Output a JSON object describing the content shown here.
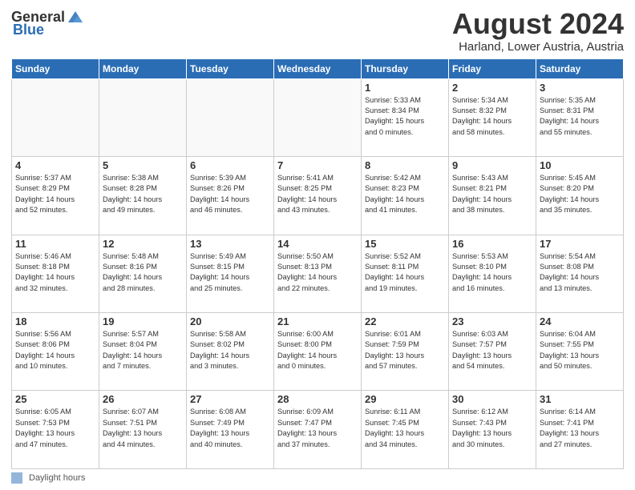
{
  "header": {
    "logo_general": "General",
    "logo_blue": "Blue",
    "title": "August 2024",
    "location": "Harland, Lower Austria, Austria"
  },
  "footer": {
    "legend_label": "Daylight hours"
  },
  "days_of_week": [
    "Sunday",
    "Monday",
    "Tuesday",
    "Wednesday",
    "Thursday",
    "Friday",
    "Saturday"
  ],
  "weeks": [
    [
      {
        "day": "",
        "info": ""
      },
      {
        "day": "",
        "info": ""
      },
      {
        "day": "",
        "info": ""
      },
      {
        "day": "",
        "info": ""
      },
      {
        "day": "1",
        "info": "Sunrise: 5:33 AM\nSunset: 8:34 PM\nDaylight: 15 hours\nand 0 minutes."
      },
      {
        "day": "2",
        "info": "Sunrise: 5:34 AM\nSunset: 8:32 PM\nDaylight: 14 hours\nand 58 minutes."
      },
      {
        "day": "3",
        "info": "Sunrise: 5:35 AM\nSunset: 8:31 PM\nDaylight: 14 hours\nand 55 minutes."
      }
    ],
    [
      {
        "day": "4",
        "info": "Sunrise: 5:37 AM\nSunset: 8:29 PM\nDaylight: 14 hours\nand 52 minutes."
      },
      {
        "day": "5",
        "info": "Sunrise: 5:38 AM\nSunset: 8:28 PM\nDaylight: 14 hours\nand 49 minutes."
      },
      {
        "day": "6",
        "info": "Sunrise: 5:39 AM\nSunset: 8:26 PM\nDaylight: 14 hours\nand 46 minutes."
      },
      {
        "day": "7",
        "info": "Sunrise: 5:41 AM\nSunset: 8:25 PM\nDaylight: 14 hours\nand 43 minutes."
      },
      {
        "day": "8",
        "info": "Sunrise: 5:42 AM\nSunset: 8:23 PM\nDaylight: 14 hours\nand 41 minutes."
      },
      {
        "day": "9",
        "info": "Sunrise: 5:43 AM\nSunset: 8:21 PM\nDaylight: 14 hours\nand 38 minutes."
      },
      {
        "day": "10",
        "info": "Sunrise: 5:45 AM\nSunset: 8:20 PM\nDaylight: 14 hours\nand 35 minutes."
      }
    ],
    [
      {
        "day": "11",
        "info": "Sunrise: 5:46 AM\nSunset: 8:18 PM\nDaylight: 14 hours\nand 32 minutes."
      },
      {
        "day": "12",
        "info": "Sunrise: 5:48 AM\nSunset: 8:16 PM\nDaylight: 14 hours\nand 28 minutes."
      },
      {
        "day": "13",
        "info": "Sunrise: 5:49 AM\nSunset: 8:15 PM\nDaylight: 14 hours\nand 25 minutes."
      },
      {
        "day": "14",
        "info": "Sunrise: 5:50 AM\nSunset: 8:13 PM\nDaylight: 14 hours\nand 22 minutes."
      },
      {
        "day": "15",
        "info": "Sunrise: 5:52 AM\nSunset: 8:11 PM\nDaylight: 14 hours\nand 19 minutes."
      },
      {
        "day": "16",
        "info": "Sunrise: 5:53 AM\nSunset: 8:10 PM\nDaylight: 14 hours\nand 16 minutes."
      },
      {
        "day": "17",
        "info": "Sunrise: 5:54 AM\nSunset: 8:08 PM\nDaylight: 14 hours\nand 13 minutes."
      }
    ],
    [
      {
        "day": "18",
        "info": "Sunrise: 5:56 AM\nSunset: 8:06 PM\nDaylight: 14 hours\nand 10 minutes."
      },
      {
        "day": "19",
        "info": "Sunrise: 5:57 AM\nSunset: 8:04 PM\nDaylight: 14 hours\nand 7 minutes."
      },
      {
        "day": "20",
        "info": "Sunrise: 5:58 AM\nSunset: 8:02 PM\nDaylight: 14 hours\nand 3 minutes."
      },
      {
        "day": "21",
        "info": "Sunrise: 6:00 AM\nSunset: 8:00 PM\nDaylight: 14 hours\nand 0 minutes."
      },
      {
        "day": "22",
        "info": "Sunrise: 6:01 AM\nSunset: 7:59 PM\nDaylight: 13 hours\nand 57 minutes."
      },
      {
        "day": "23",
        "info": "Sunrise: 6:03 AM\nSunset: 7:57 PM\nDaylight: 13 hours\nand 54 minutes."
      },
      {
        "day": "24",
        "info": "Sunrise: 6:04 AM\nSunset: 7:55 PM\nDaylight: 13 hours\nand 50 minutes."
      }
    ],
    [
      {
        "day": "25",
        "info": "Sunrise: 6:05 AM\nSunset: 7:53 PM\nDaylight: 13 hours\nand 47 minutes."
      },
      {
        "day": "26",
        "info": "Sunrise: 6:07 AM\nSunset: 7:51 PM\nDaylight: 13 hours\nand 44 minutes."
      },
      {
        "day": "27",
        "info": "Sunrise: 6:08 AM\nSunset: 7:49 PM\nDaylight: 13 hours\nand 40 minutes."
      },
      {
        "day": "28",
        "info": "Sunrise: 6:09 AM\nSunset: 7:47 PM\nDaylight: 13 hours\nand 37 minutes."
      },
      {
        "day": "29",
        "info": "Sunrise: 6:11 AM\nSunset: 7:45 PM\nDaylight: 13 hours\nand 34 minutes."
      },
      {
        "day": "30",
        "info": "Sunrise: 6:12 AM\nSunset: 7:43 PM\nDaylight: 13 hours\nand 30 minutes."
      },
      {
        "day": "31",
        "info": "Sunrise: 6:14 AM\nSunset: 7:41 PM\nDaylight: 13 hours\nand 27 minutes."
      }
    ]
  ]
}
